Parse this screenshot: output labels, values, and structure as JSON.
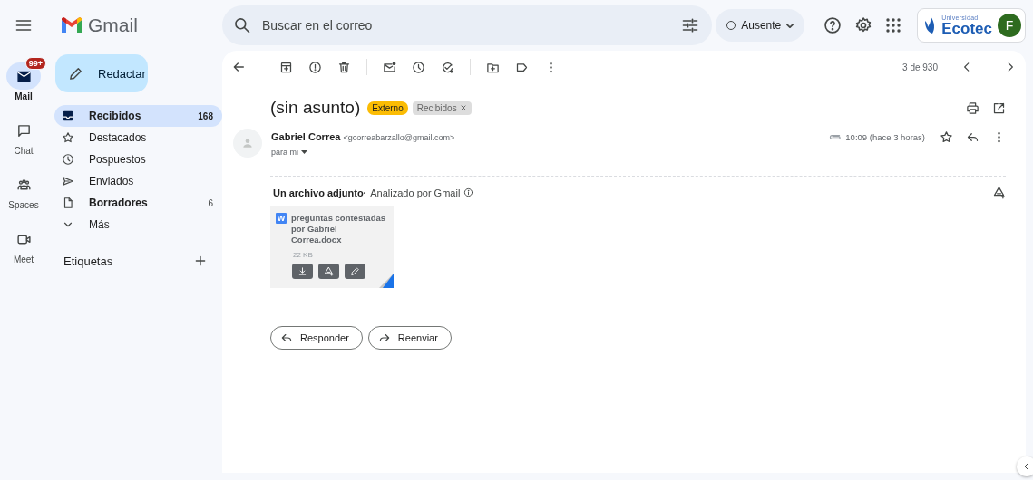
{
  "app": {
    "logo_text": "Gmail"
  },
  "search": {
    "placeholder": "Buscar en el correo"
  },
  "status": {
    "label": "Ausente"
  },
  "account": {
    "org_small": "Universidad",
    "org_name": "Ecotec",
    "avatar_letter": "F"
  },
  "rail": [
    {
      "label": "Mail",
      "badge": "99+",
      "selected": true
    },
    {
      "label": "Chat",
      "selected": false
    },
    {
      "label": "Spaces",
      "selected": false
    },
    {
      "label": "Meet",
      "selected": false
    }
  ],
  "compose": {
    "label": "Redactar"
  },
  "folders": [
    {
      "label": "Recibidos",
      "count": "168",
      "selected": true,
      "unread": true
    },
    {
      "label": "Destacados",
      "selected": false,
      "unread": false
    },
    {
      "label": "Pospuestos",
      "selected": false,
      "unread": false
    },
    {
      "label": "Enviados",
      "selected": false,
      "unread": false
    },
    {
      "label": "Borradores",
      "count": "6",
      "selected": false,
      "unread": true
    },
    {
      "label": "Más",
      "selected": false,
      "unread": false
    }
  ],
  "labels_section": {
    "title": "Etiquetas"
  },
  "toolbar": {
    "pager": "3 de 930"
  },
  "message": {
    "subject": "(sin asunto)",
    "tags": [
      {
        "label": "Externo",
        "kind": "external"
      },
      {
        "label": "Recibidos",
        "kind": "removable"
      }
    ],
    "sender_name": "Gabriel Correa",
    "sender_email": "<gcorreabarzallo@gmail.com>",
    "recipient": "para mi",
    "time": "10:09 (hace 3 horas)",
    "starred": false
  },
  "attachments": {
    "heading": "Un archivo adjunto·",
    "scan_note": "Analizado por Gmail",
    "files": [
      {
        "badge": "W",
        "name": "preguntas contestadas por Gabriel Correa.docx",
        "size": "22 KB"
      }
    ]
  },
  "actions": [
    {
      "label": "Responder",
      "kind": "reply"
    },
    {
      "label": "Reenviar",
      "kind": "forward"
    }
  ]
}
